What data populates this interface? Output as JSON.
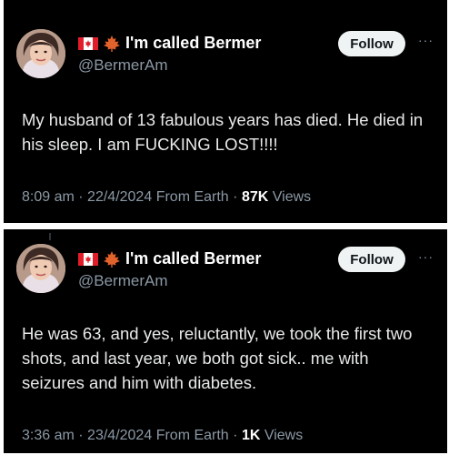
{
  "tweets": [
    {
      "author": {
        "display_name": "I'm called Bermer",
        "handle": "@BermerAm",
        "flag_icon": "canada-flag-icon",
        "leaf_icon": "maple-leaf-icon"
      },
      "follow_label": "Follow",
      "more_label": "···",
      "text": "My husband of 13 fabulous years has died. He died in his sleep. I am FUCKING LOST!!!!",
      "time": "8:09 am",
      "date": "22/4/2024",
      "source": "From Earth",
      "sep": "·",
      "views_count": "87K",
      "views_label": "Views"
    },
    {
      "author": {
        "display_name": "I'm called Bermer",
        "handle": "@BermerAm",
        "flag_icon": "canada-flag-icon",
        "leaf_icon": "maple-leaf-icon"
      },
      "follow_label": "Follow",
      "more_label": "···",
      "text": "He was 63, and yes, reluctantly, we took the first two shots, and last year, we both got sick.. me with seizures and him with diabetes.",
      "time": "3:36 am",
      "date": "23/4/2024",
      "source": "From Earth",
      "sep": "·",
      "views_count": "1K",
      "views_label": "Views"
    }
  ],
  "colors": {
    "background": "#000000",
    "text": "#e7e9ea",
    "muted": "#8b98a5",
    "button_bg": "#eff3f4",
    "flag_red": "#e11d2a",
    "leaf_orange": "#e2622b"
  }
}
